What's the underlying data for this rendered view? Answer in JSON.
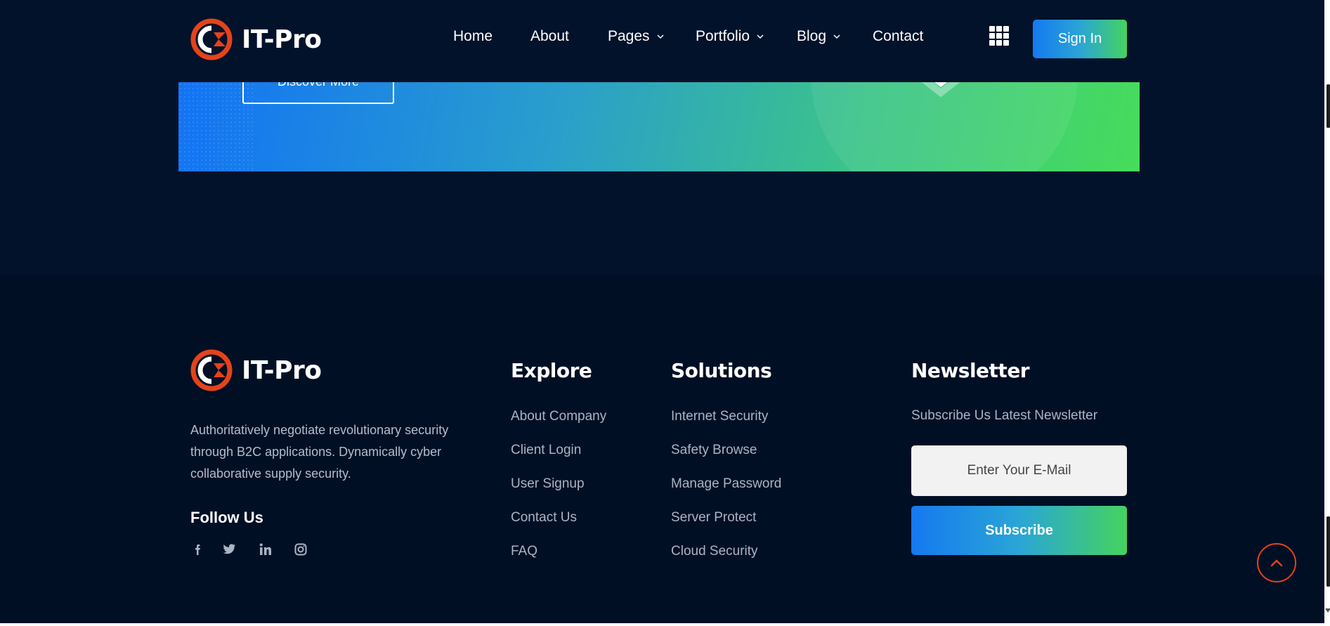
{
  "brand": {
    "name": "IT-Pro",
    "accent": "#e5431a"
  },
  "header": {
    "nav": [
      {
        "label": "Home",
        "dropdown": false
      },
      {
        "label": "About",
        "dropdown": false
      },
      {
        "label": "Pages",
        "dropdown": true
      },
      {
        "label": "Portfolio",
        "dropdown": true
      },
      {
        "label": "Blog",
        "dropdown": true
      },
      {
        "label": "Contact",
        "dropdown": false
      }
    ],
    "apps_icon": "grid-icon",
    "signin_label": "Sign In"
  },
  "banner": {
    "button_label": "Discover More",
    "gradient": [
      "#1273f5",
      "#46dc5b"
    ]
  },
  "footer": {
    "about_text": "Authoritatively negotiate revolutionary security through B2C applications. Dynamically cyber collaborative supply security.",
    "follow_title": "Follow Us",
    "social": [
      "facebook-icon",
      "twitter-icon",
      "linkedin-icon",
      "instagram-icon"
    ],
    "explore": {
      "title": "Explore",
      "links": [
        "About Company",
        "Client Login",
        "User Signup",
        "Contact Us",
        "FAQ"
      ]
    },
    "solutions": {
      "title": "Solutions",
      "links": [
        "Internet Security",
        "Safety Browse",
        "Manage Password",
        "Server Protect",
        "Cloud Security"
      ]
    },
    "newsletter": {
      "title": "Newsletter",
      "subtitle": "Subscribe Us Latest Newsletter",
      "email_placeholder": "Enter Your E-Mail",
      "subscribe_label": "Subscribe"
    },
    "scroll_top_icon": "chevron-up-icon"
  }
}
